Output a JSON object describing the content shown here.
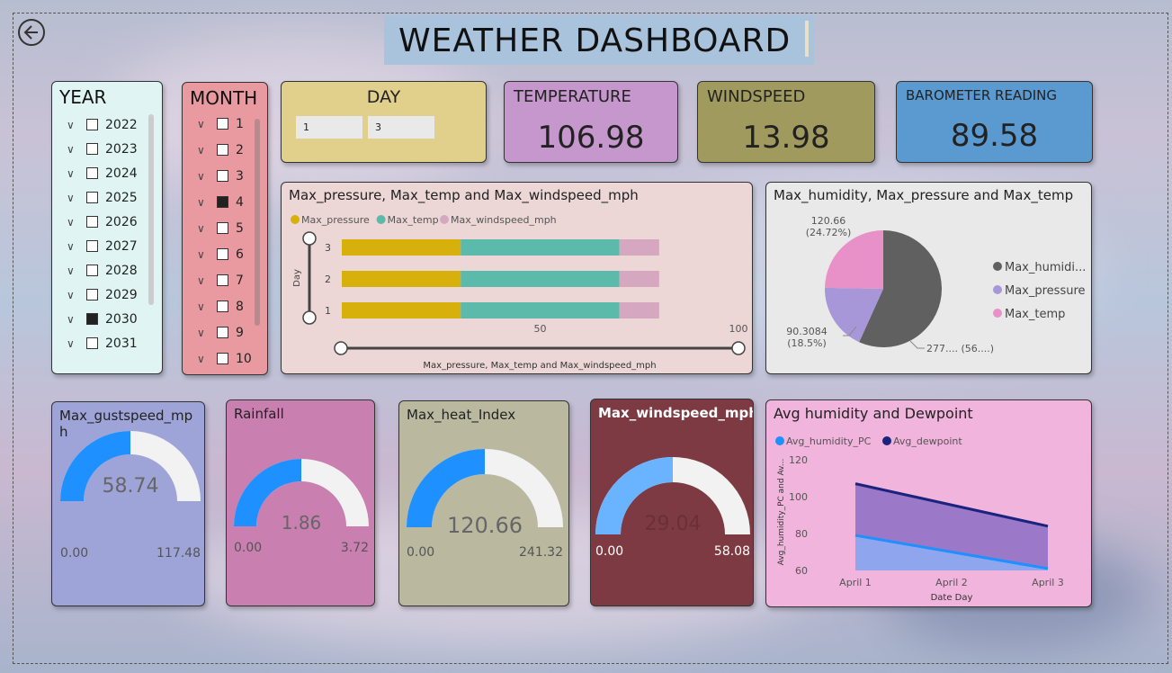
{
  "header": {
    "title": "WEATHER DASHBOARD"
  },
  "year_slicer": {
    "title": "YEAR",
    "options": [
      {
        "label": "2022",
        "checked": false
      },
      {
        "label": "2023",
        "checked": false
      },
      {
        "label": "2024",
        "checked": false
      },
      {
        "label": "2025",
        "checked": false
      },
      {
        "label": "2026",
        "checked": false
      },
      {
        "label": "2027",
        "checked": false
      },
      {
        "label": "2028",
        "checked": false
      },
      {
        "label": "2029",
        "checked": false
      },
      {
        "label": "2030",
        "checked": true
      },
      {
        "label": "2031",
        "checked": false
      }
    ]
  },
  "month_slicer": {
    "title": "MONTH",
    "options": [
      {
        "label": "1",
        "checked": false
      },
      {
        "label": "2",
        "checked": false
      },
      {
        "label": "3",
        "checked": false
      },
      {
        "label": "4",
        "checked": true
      },
      {
        "label": "5",
        "checked": false
      },
      {
        "label": "6",
        "checked": false
      },
      {
        "label": "7",
        "checked": false
      },
      {
        "label": "8",
        "checked": false
      },
      {
        "label": "9",
        "checked": false
      },
      {
        "label": "10",
        "checked": false
      }
    ]
  },
  "day_slicer": {
    "title": "DAY",
    "from": "1",
    "to": "3"
  },
  "kpis": {
    "temperature": {
      "label": "TEMPERATURE",
      "value": "106.98"
    },
    "windspeed": {
      "label": "WINDSPEED",
      "value": "13.98"
    },
    "barometer": {
      "label": "BAROMETER READING",
      "value": "89.58"
    }
  },
  "chart_data": [
    {
      "type": "bar",
      "orientation": "horizontal-stacked",
      "title": "Max_pressure, Max_temp and Max_windspeed_mph",
      "categories": [
        "3",
        "2",
        "1"
      ],
      "series": [
        {
          "name": "Max_pressure",
          "values": [
            30,
            30,
            30
          ],
          "color": "#d8b00c"
        },
        {
          "name": "Max_temp",
          "values": [
            40,
            40,
            40
          ],
          "color": "#5bbaa9"
        },
        {
          "name": "Max_windspeed_mph",
          "values": [
            10,
            10,
            10
          ],
          "color": "#d6a8bf"
        }
      ],
      "xlabel": "Max_pressure, Max_temp and Max_windspeed_mph",
      "ylabel": "Day",
      "xticks": [
        "50",
        "100"
      ],
      "xlim": [
        0,
        100
      ]
    },
    {
      "type": "pie",
      "title": "Max_humidity, Max_pressure and Max_temp",
      "slices": [
        {
          "name": "Max_humidi...",
          "value": 277,
          "color": "#606060"
        },
        {
          "name": "Max_pressure",
          "value": 90.3084,
          "color": "#a897d8"
        },
        {
          "name": "Max_temp",
          "value": 120.66,
          "color": "#e890c8"
        }
      ],
      "labels": {
        "temp": [
          "120.66",
          "(24.72%)"
        ],
        "pressure": [
          "90.3084",
          "(18.5%)"
        ],
        "humidity": "277.... (56....)"
      },
      "legend": "right"
    },
    {
      "type": "area",
      "title": "Avg humidity and Dewpoint",
      "categories": [
        "April 1",
        "April 2",
        "April 3"
      ],
      "series": [
        {
          "name": "Avg_humidity_PC",
          "values": [
            79,
            70,
            61
          ],
          "color": "#1e90ff"
        },
        {
          "name": "Avg_dewpoint",
          "values": [
            107,
            95.5,
            84
          ],
          "color": "#1a237e"
        }
      ],
      "xlabel": "Date Day",
      "ylabel": "Avg_humidity_PC and Av...",
      "yticks": [
        "60",
        "80",
        "100",
        "120"
      ],
      "ylim": [
        60,
        120
      ]
    }
  ],
  "gauges": [
    {
      "title": "Max_gustspeed_mp h",
      "value": 58.74,
      "max": 117.48,
      "value_label": "58.74",
      "min_label": "0.00",
      "max_label": "117.48",
      "bg": "#9ea4d8",
      "fill": "#1e90ff"
    },
    {
      "title": "Rainfall",
      "value": 1.86,
      "max": 3.72,
      "value_label": "1.86",
      "min_label": "0.00",
      "max_label": "3.72",
      "bg": "#c97fb0",
      "fill": "#1e90ff"
    },
    {
      "title": "Max_heat_Index",
      "value": 120.66,
      "max": 241.32,
      "value_label": "120.66",
      "min_label": "0.00",
      "max_label": "241.32",
      "bg": "#bbb8a0",
      "fill": "#1e90ff"
    },
    {
      "title": "Max_windspeed_mph",
      "value": 29.04,
      "max": 58.08,
      "value_label": "29.04",
      "min_label": "0.00",
      "max_label": "58.08",
      "bg": "#7d3a42",
      "fill": "#6ab4ff"
    }
  ]
}
